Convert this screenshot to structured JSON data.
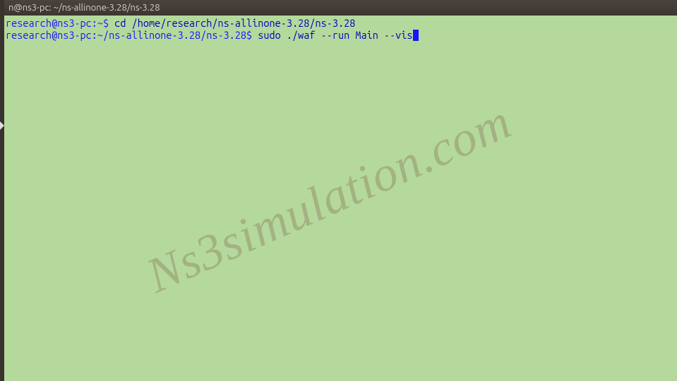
{
  "titlebar": {
    "text": "n@ns3-pc: ~/ns-allinone-3.28/ns-3.28"
  },
  "terminal": {
    "lines": [
      {
        "prompt": "research@ns3-pc:~$",
        "command": " cd /home/research/ns-allinone-3.28/ns-3.28"
      },
      {
        "prompt": "research@ns3-pc:~/ns-allinone-3.28/ns-3.28$",
        "command": " sudo ./waf --run Main --vis"
      }
    ]
  },
  "watermark": "Ns3simulation.com"
}
